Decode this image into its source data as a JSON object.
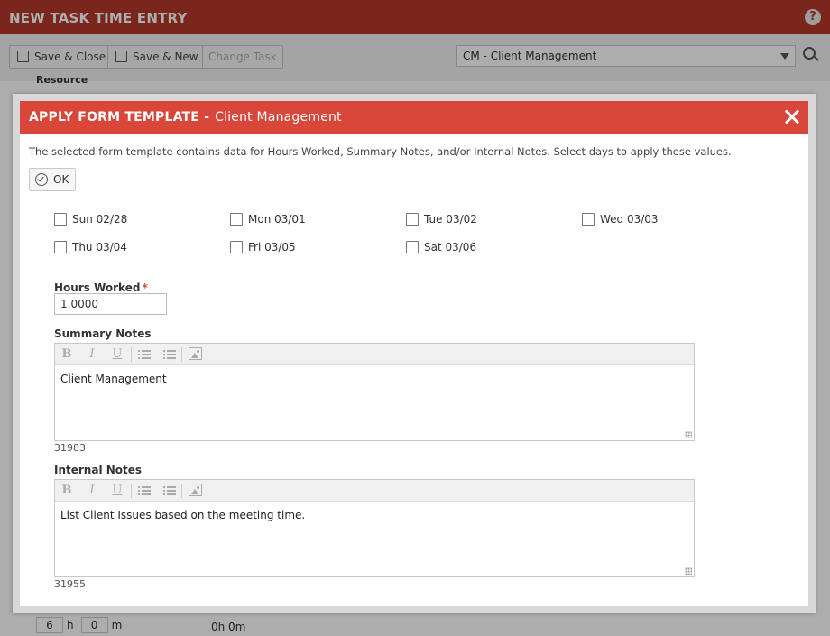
{
  "background": {
    "title": "NEW TASK TIME ENTRY",
    "help_icon": "question-circle-icon",
    "toolbar": {
      "save_close": "Save & Close",
      "save_new": "Save & New",
      "change_task": "Change Task"
    },
    "task_select": {
      "value": "CM - Client Management"
    },
    "resource_label": "Resource",
    "footer": {
      "hours": "6",
      "hours_unit": "h",
      "minutes": "0",
      "minutes_unit": "m",
      "total": "0h 0m"
    }
  },
  "modal": {
    "title": "APPLY FORM TEMPLATE -",
    "subtitle": "Client Management",
    "instructions": "The selected form template contains data for Hours Worked, Summary Notes, and/or Internal Notes. Select days to apply these values.",
    "ok_label": "OK",
    "days": [
      {
        "label": "Sun 02/28",
        "checked": false
      },
      {
        "label": "Mon 03/01",
        "checked": false
      },
      {
        "label": "Tue 03/02",
        "checked": false
      },
      {
        "label": "Wed 03/03",
        "checked": false
      },
      {
        "label": "Thu 03/04",
        "checked": false
      },
      {
        "label": "Fri 03/05",
        "checked": false
      },
      {
        "label": "Sat 03/06",
        "checked": false
      }
    ],
    "hours_worked": {
      "label": "Hours Worked",
      "required_mark": "*",
      "value": "1.0000"
    },
    "summary_notes": {
      "label": "Summary Notes",
      "text": "Client Management",
      "count": "31983"
    },
    "internal_notes": {
      "label": "Internal Notes",
      "text": "List Client Issues based on the meeting time.",
      "count": "31955"
    },
    "toolbar": {
      "bold": "B",
      "italic": "I",
      "underline": "U"
    }
  },
  "colors": {
    "accent": "#d9473a",
    "bg_titlebar": "#b5392c"
  }
}
